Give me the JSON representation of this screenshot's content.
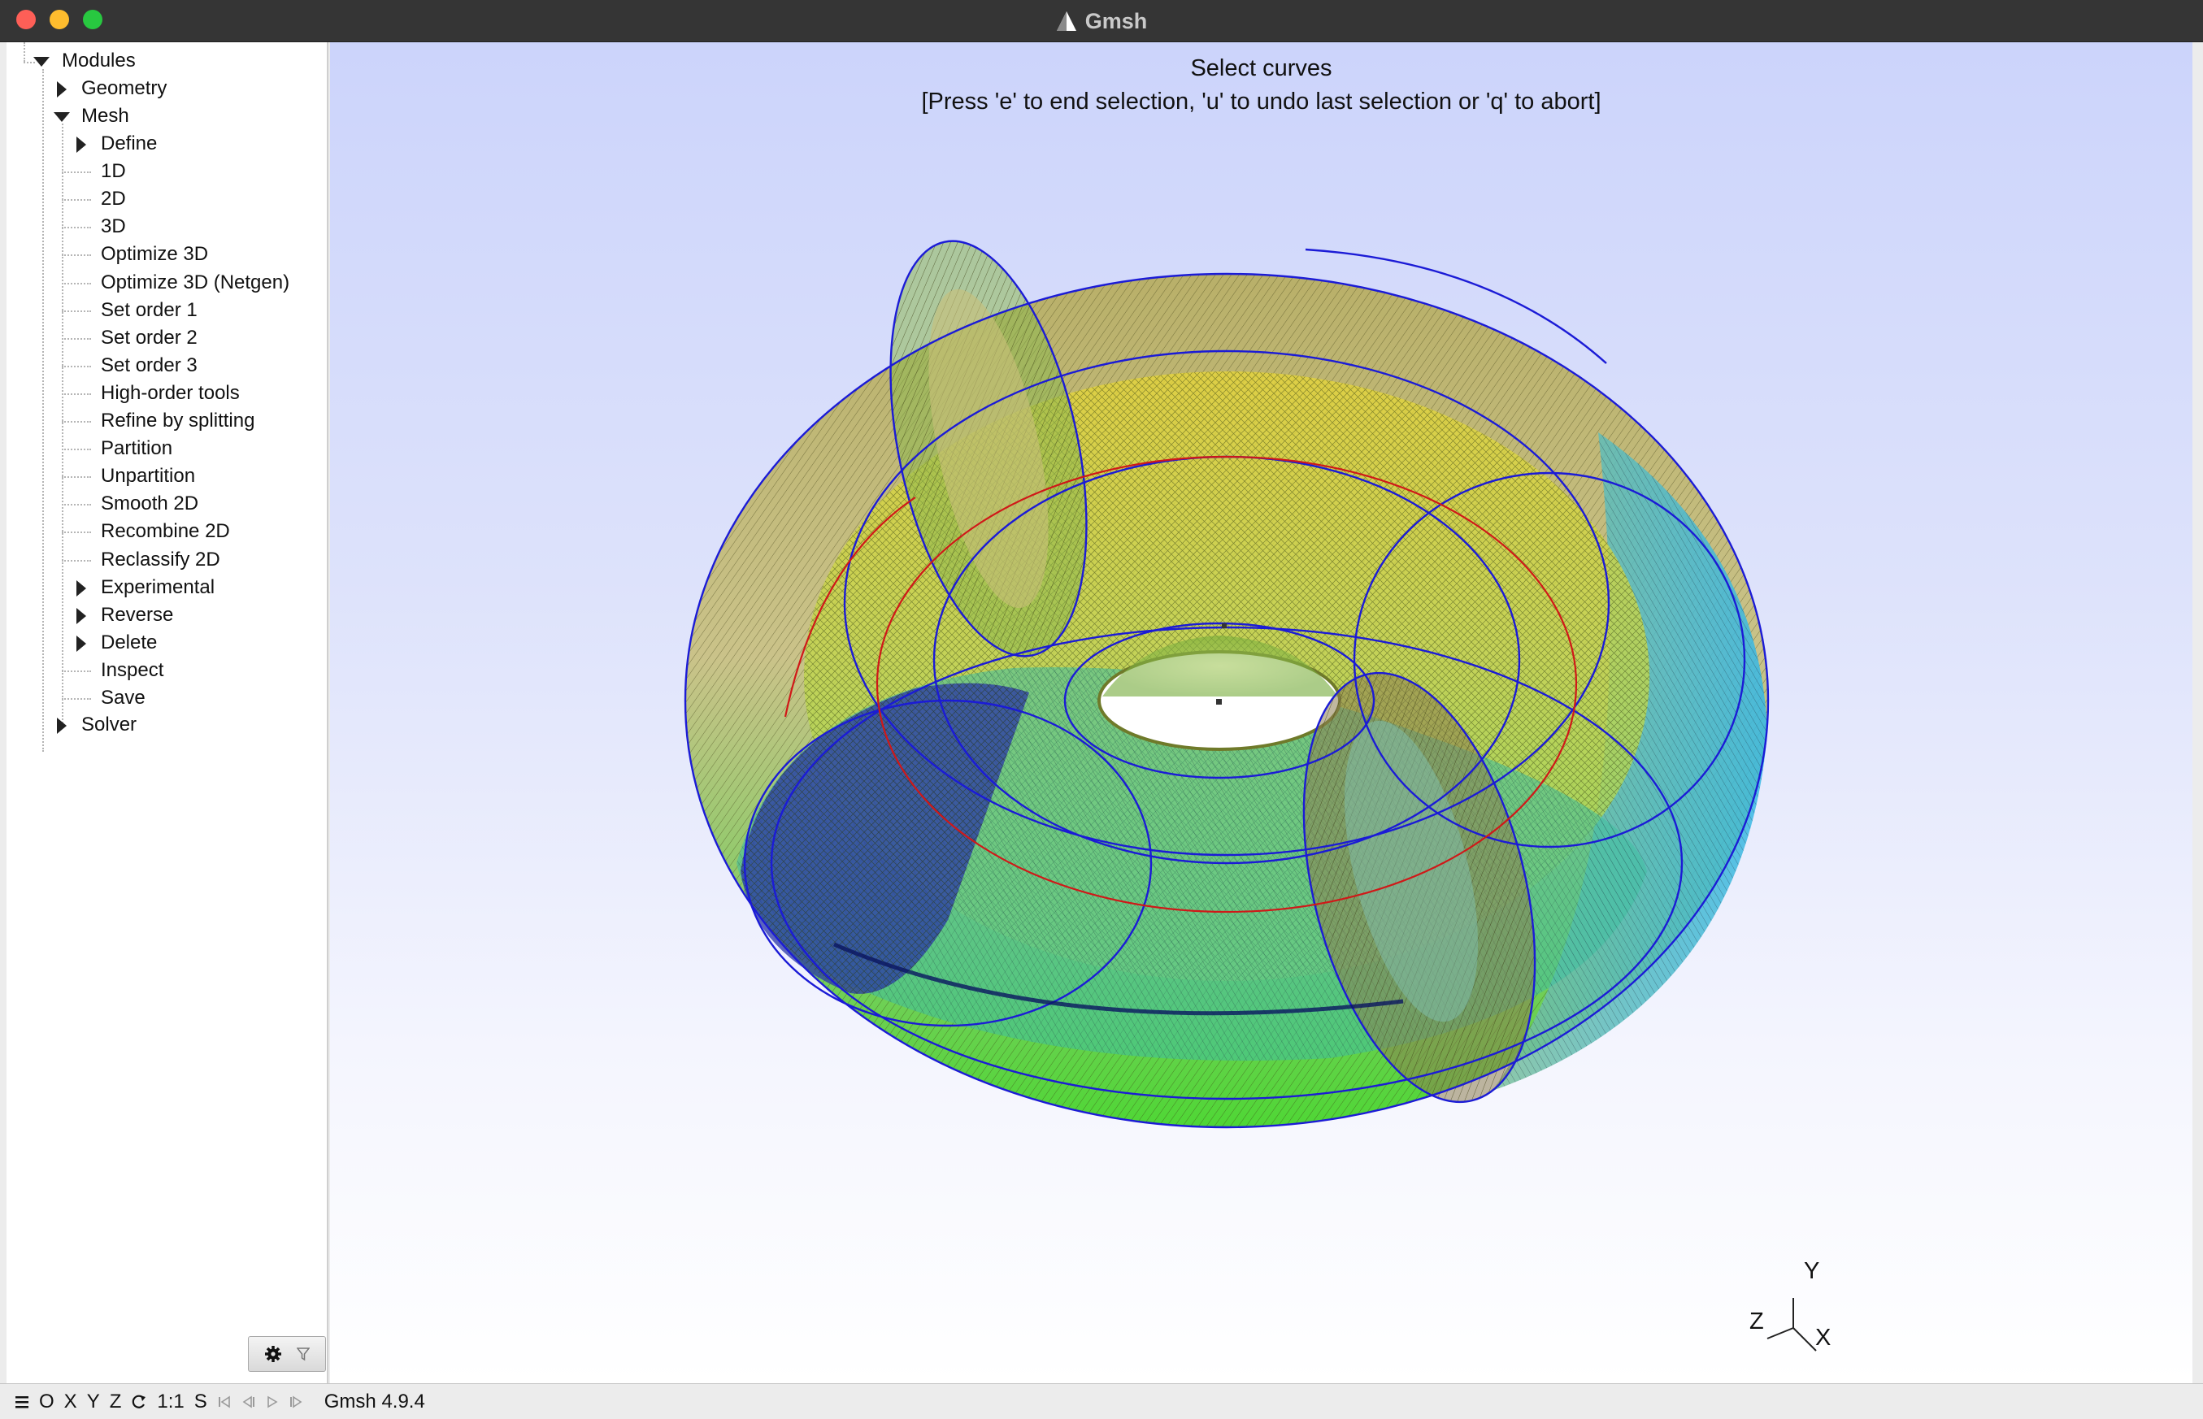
{
  "window": {
    "title": "Gmsh",
    "app_icon": "gmsh-triangle-icon",
    "controls": [
      "close",
      "minimize",
      "maximize"
    ]
  },
  "tree": {
    "root": "Modules",
    "geometry": "Geometry",
    "mesh": "Mesh",
    "mesh_children": [
      {
        "label": "Define",
        "expandable": true
      },
      {
        "label": "1D",
        "expandable": false
      },
      {
        "label": "2D",
        "expandable": false
      },
      {
        "label": "3D",
        "expandable": false
      },
      {
        "label": "Optimize 3D",
        "expandable": false
      },
      {
        "label": "Optimize 3D (Netgen)",
        "expandable": false
      },
      {
        "label": "Set order 1",
        "expandable": false
      },
      {
        "label": "Set order 2",
        "expandable": false
      },
      {
        "label": "Set order 3",
        "expandable": false
      },
      {
        "label": "High-order tools",
        "expandable": false
      },
      {
        "label": "Refine by splitting",
        "expandable": false
      },
      {
        "label": "Partition",
        "expandable": false
      },
      {
        "label": "Unpartition",
        "expandable": false
      },
      {
        "label": "Smooth 2D",
        "expandable": false
      },
      {
        "label": "Recombine 2D",
        "expandable": false
      },
      {
        "label": "Reclassify 2D",
        "expandable": false
      },
      {
        "label": "Experimental",
        "expandable": true
      },
      {
        "label": "Reverse",
        "expandable": true
      },
      {
        "label": "Delete",
        "expandable": true
      },
      {
        "label": "Inspect",
        "expandable": false
      },
      {
        "label": "Save",
        "expandable": false
      }
    ],
    "solver": "Solver"
  },
  "viewport": {
    "message_line1": "Select curves",
    "message_line2": "[Press 'e' to end selection, 'u' to undo last selection or 'q' to abort]",
    "axes": {
      "y": "Y",
      "z": "Z",
      "x": "X"
    }
  },
  "statusbar": {
    "menu_icon": "hamburger-icon",
    "buttons": [
      "O",
      "X",
      "Y",
      "Z"
    ],
    "rotate_icon": "rotate-icon",
    "scale": "1:1",
    "select": "S",
    "playback_icons": [
      "first-step-icon",
      "step-back-icon",
      "play-icon",
      "step-forward-icon"
    ],
    "version": "Gmsh 4.9.4"
  },
  "colors": {
    "background_top": "#ccd4fb",
    "background_bottom": "#ffffff",
    "selected_curve": "#1b1bd6",
    "highlight_curve": "#d01818"
  }
}
